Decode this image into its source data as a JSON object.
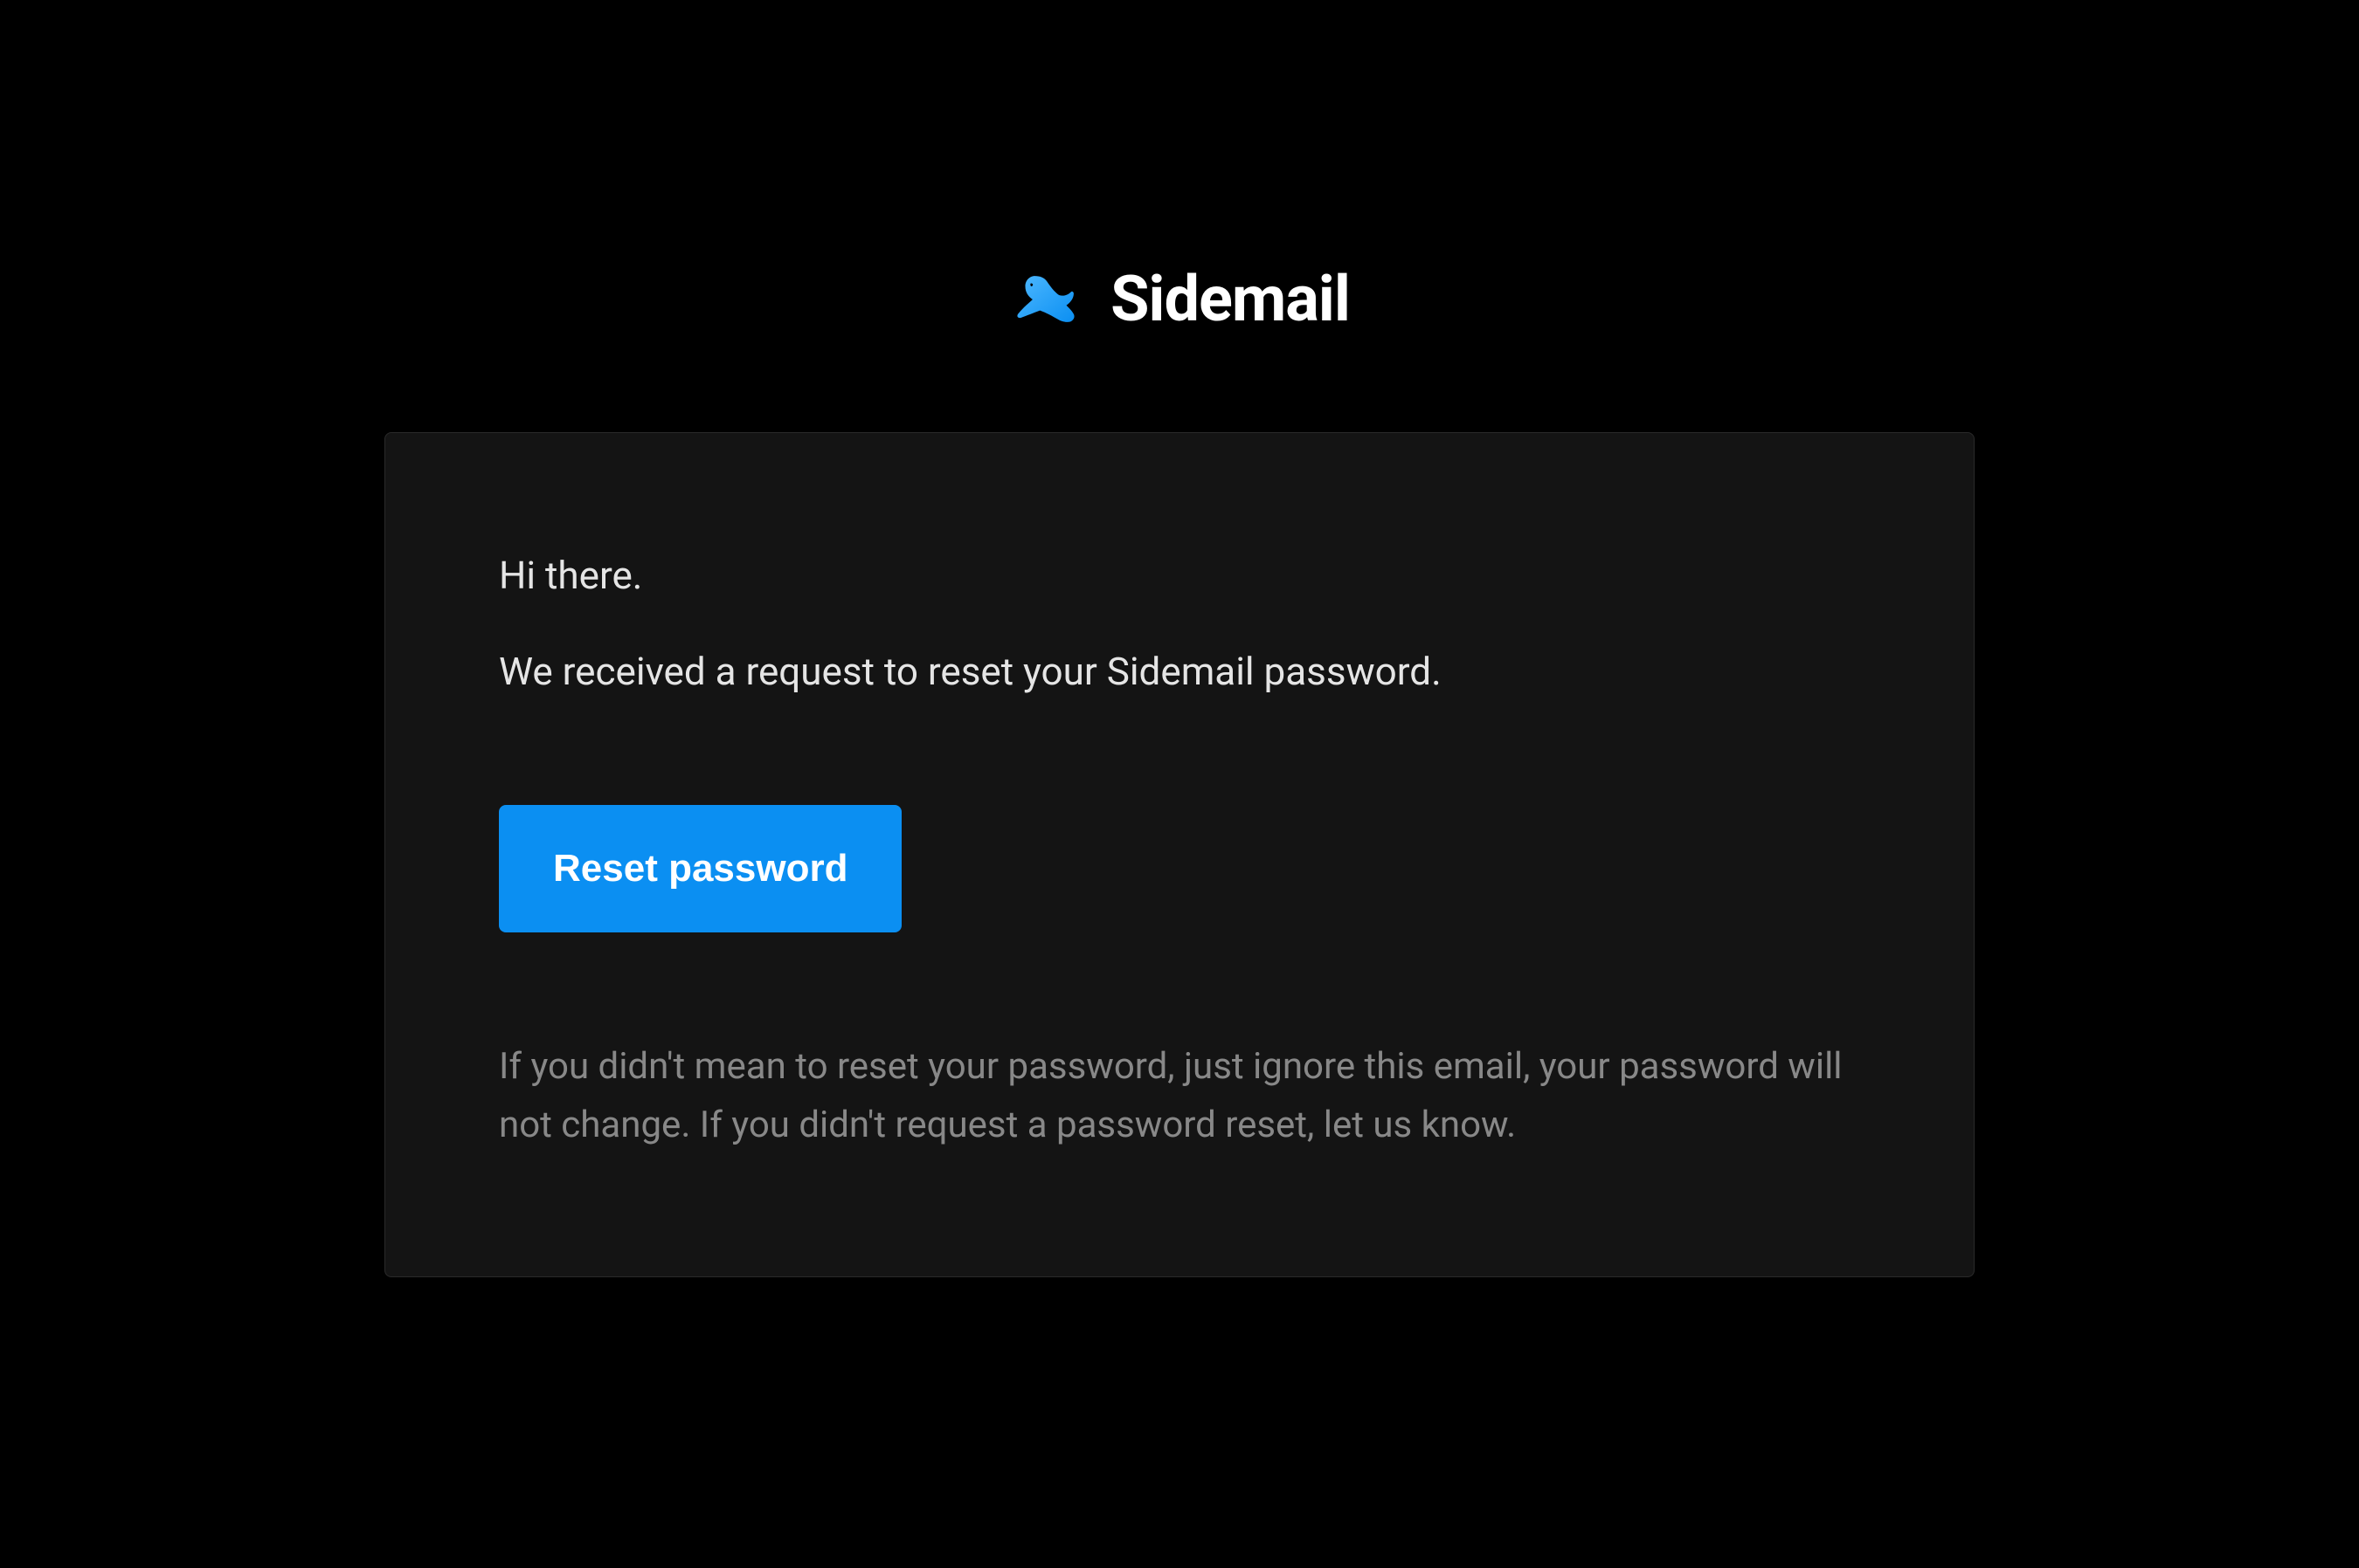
{
  "brand": {
    "name": "Sidemail"
  },
  "email": {
    "greeting": "Hi there.",
    "message": "We received a request to reset your Sidemail password.",
    "button_label": "Reset password",
    "disclaimer": "If you didn't mean to reset your password, just ignore this email, your password will not change. If you didn't request a password reset, let us know."
  },
  "colors": {
    "background": "#000000",
    "card_background": "#141414",
    "card_border": "#2a2a2a",
    "text_primary": "#e5e5e5",
    "text_secondary": "#888888",
    "button": "#0b8ff2",
    "button_text": "#ffffff",
    "logo_text": "#ffffff"
  }
}
